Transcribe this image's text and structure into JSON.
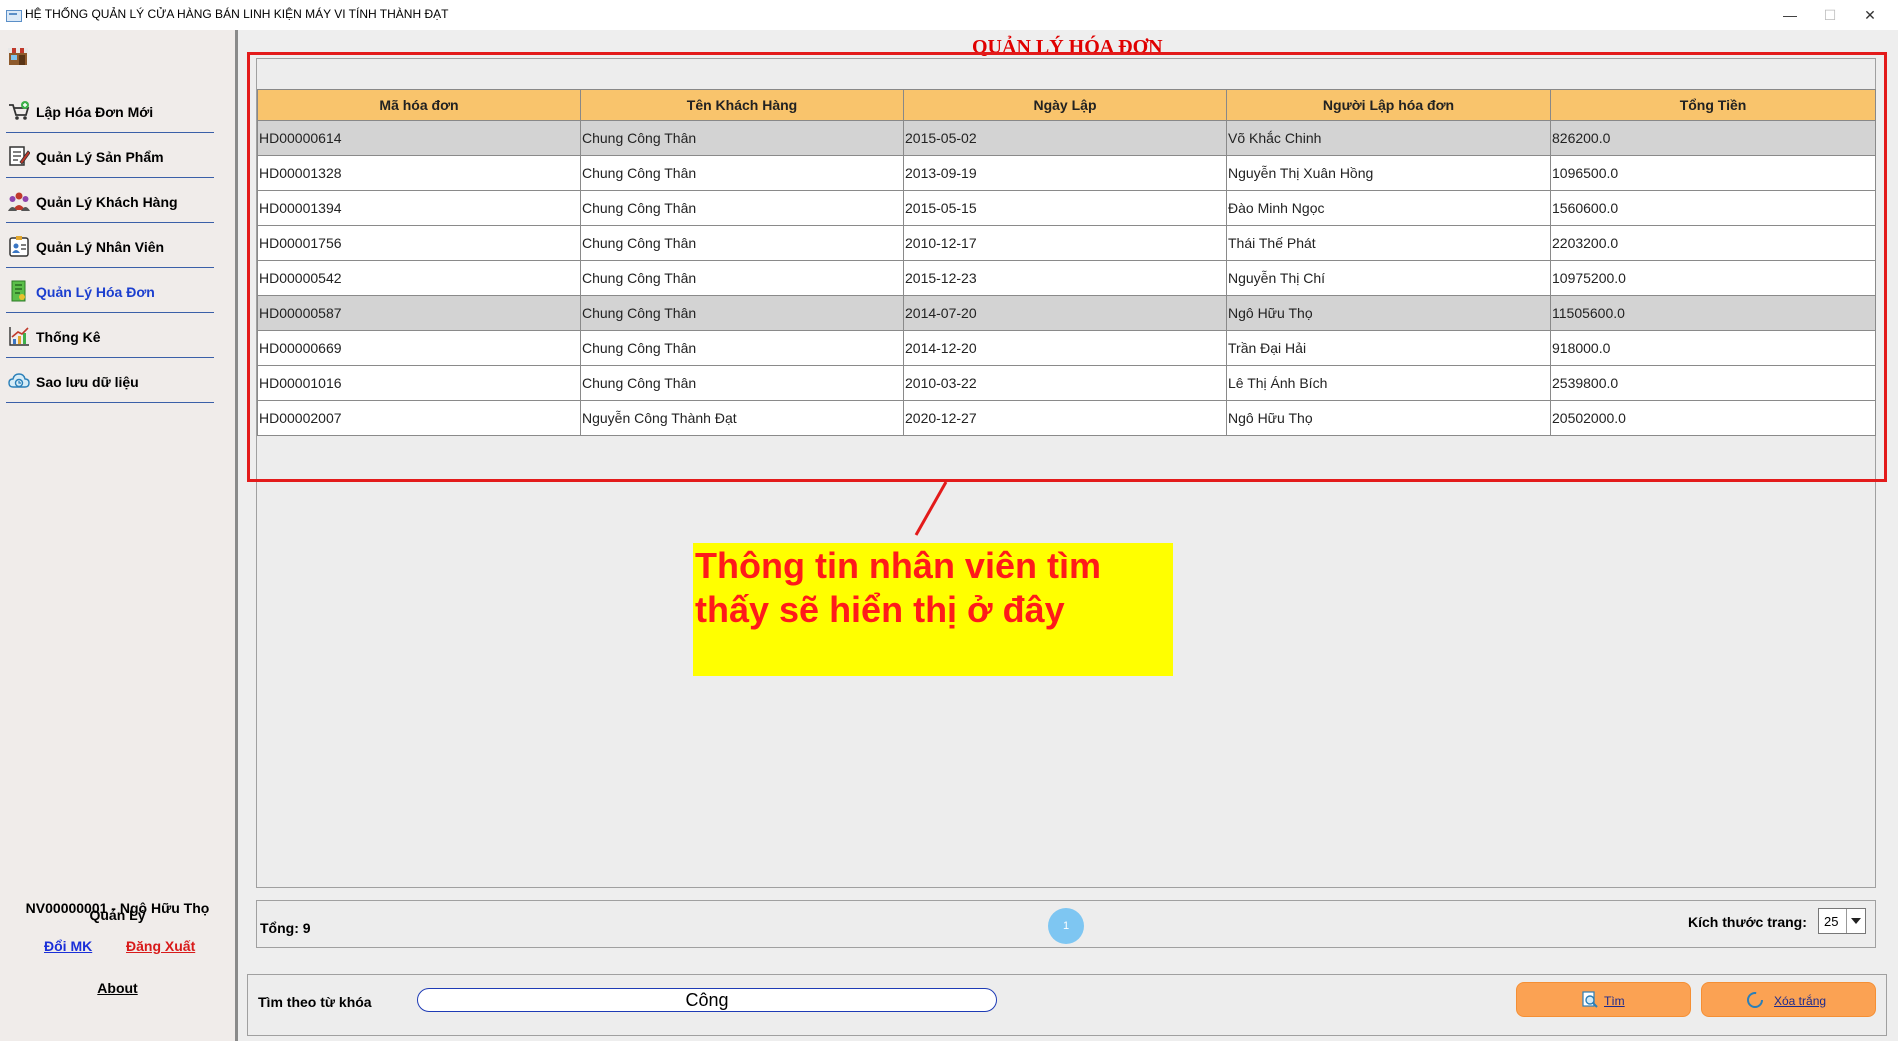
{
  "window": {
    "title": "HỆ THỐNG QUẢN LÝ CỬA HÀNG BÁN LINH KIỆN MÁY VI TÍNH THÀNH ĐẠT",
    "minimize": "—",
    "maximize": "☐",
    "close": "✕"
  },
  "sidebar": {
    "items": [
      {
        "label": "Lập Hóa Đơn Mới",
        "icon": "cart-add-icon"
      },
      {
        "label": "Quản Lý Sản Phẩm",
        "icon": "edit-document-icon"
      },
      {
        "label": "Quản Lý Khách Hàng",
        "icon": "customers-icon"
      },
      {
        "label": "Quản Lý Nhân Viên",
        "icon": "employee-badge-icon"
      },
      {
        "label": "Quản Lý Hóa Đơn",
        "icon": "invoice-icon"
      },
      {
        "label": "Thống Kê",
        "icon": "chart-growth-icon"
      },
      {
        "label": "Sao lưu dữ liệu",
        "icon": "cloud-backup-icon"
      }
    ],
    "active_item": "Quản Lý Hóa Đơn",
    "user": "NV00000001 - Ngô Hữu  Thọ",
    "role": "Quản Lý",
    "change_password": "Đổi MK",
    "logout": "Đăng Xuất",
    "about": "About"
  },
  "main": {
    "title": "QUẢN LÝ HÓA ĐƠN",
    "table": {
      "columns": [
        "Mã hóa đơn",
        "Tên Khách Hàng",
        "Ngày Lập",
        "Người Lập hóa đơn",
        "Tổng Tiền"
      ],
      "rows": [
        [
          "HD00000614",
          "Chung Công Thân",
          "2015-05-02",
          "Võ Khắc Chinh",
          "826200.0"
        ],
        [
          "HD00001328",
          "Chung Công Thân",
          "2013-09-19",
          "Nguyễn Thị Xuân  Hồng",
          "1096500.0"
        ],
        [
          "HD00001394",
          "Chung Công Thân",
          "2015-05-15",
          "Đào Minh Ngọc",
          "1560600.0"
        ],
        [
          "HD00001756",
          "Chung Công Thân",
          "2010-12-17",
          "Thái Thế  Phát",
          "2203200.0"
        ],
        [
          "HD00000542",
          "Chung Công Thân",
          "2015-12-23",
          "Nguyễn Thị   Chí",
          "10975200.0"
        ],
        [
          "HD00000587",
          "Chung Công Thân",
          "2014-07-20",
          "Ngô Hữu  Thọ",
          "11505600.0"
        ],
        [
          "HD00000669",
          "Chung Công Thân",
          "2014-12-20",
          "Trần Đại Hải",
          "918000.0"
        ],
        [
          "HD00001016",
          "Chung Công Thân",
          "2010-03-22",
          "Lê Thị Ánh  Bích",
          "2539800.0"
        ],
        [
          "HD00002007",
          "Nguyễn Công Thành Đạt",
          "2020-12-27",
          "Ngô Hữu  Thọ",
          "20502000.0"
        ]
      ],
      "highlighted_rows": [
        0,
        5
      ]
    },
    "callout_text": "Thông tin nhân viên tìm thấy sẽ hiển thị ở đây",
    "pager": {
      "total": "Tổng: 9",
      "current_page": "1",
      "page_size_label": "Kích thước trang:",
      "page_size": "25"
    },
    "search": {
      "label": "Tìm theo từ khóa",
      "value": "Công",
      "search_button": "Tìm",
      "clear_button": "Xóa trắng"
    }
  },
  "colors": {
    "header_bg": "#f9c46c",
    "highlight_row": "#d3d3d3",
    "annotation_red": "#e31b1b",
    "callout_bg": "#ffff00",
    "button_orange": "#fba253",
    "active_nav": "#1c3fcf"
  }
}
